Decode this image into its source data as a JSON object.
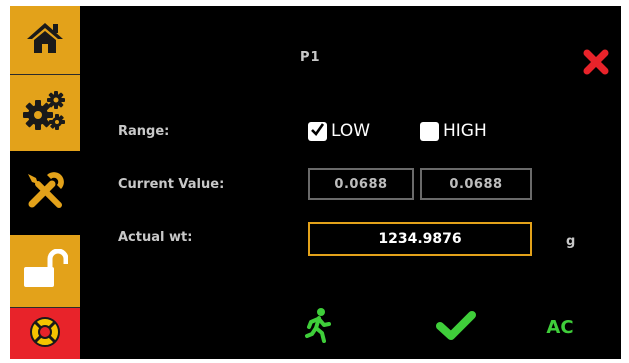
{
  "sidebar": {
    "items": [
      {
        "name": "home",
        "icon": "home-icon",
        "state": "default"
      },
      {
        "name": "settings",
        "icon": "gears-icon",
        "state": "default"
      },
      {
        "name": "tools",
        "icon": "wrench-screwdriver-icon",
        "state": "active"
      },
      {
        "name": "unlock",
        "icon": "unlock-icon",
        "state": "default"
      },
      {
        "name": "help",
        "icon": "lifebuoy-icon",
        "state": "default"
      }
    ]
  },
  "header": {
    "title": "P1",
    "close_icon": "close-icon"
  },
  "form": {
    "range": {
      "label": "Range:",
      "options": [
        {
          "label": "LOW",
          "checked": true
        },
        {
          "label": "HIGH",
          "checked": false
        }
      ]
    },
    "current_value": {
      "label": "Current Value:",
      "values": [
        "0.0688",
        "0.0688"
      ]
    },
    "actual_wt": {
      "label": "Actual wt:",
      "value": "1234.9876",
      "unit": "g"
    }
  },
  "footer": {
    "walk_icon": "walking-person-icon",
    "confirm_icon": "checkmark-icon",
    "ac_label": "AC"
  },
  "colors": {
    "accent": "#e3a21a",
    "close": "#e8232a",
    "confirm": "#3fce3a",
    "background": "#000000",
    "help_red": "#e8232a"
  }
}
